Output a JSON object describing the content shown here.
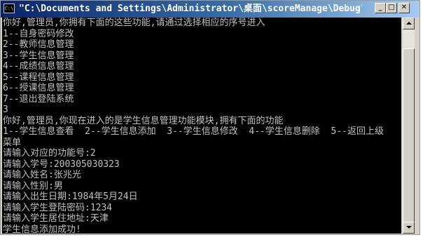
{
  "window": {
    "title": "\"C:\\Documents and Settings\\Administrator\\桌面\\scoreManage\\Debug\\score...",
    "icon_label": "C:\\",
    "icon": "console-app-icon"
  },
  "controls": {
    "minimize_symbol": "_",
    "maximize_symbol": "□",
    "close_symbol": "✕"
  },
  "console": {
    "lines": [
      "你好,管理员,你拥有下面的这些功能,请通过选择相应的序号进入",
      "1--自身密码修改",
      "2--教师信息管理",
      "3--学生信息管理",
      "4--成绩信息管理",
      "5--课程信息管理",
      "6--授课信息管理",
      "7--退出登陆系统",
      "3",
      "你好,管理员,你现在进入的是学生信息管理功能模块,拥有下面的功能",
      "1--学生信息查看  2--学生信息添加  3--学生信息修改  4--学生信息删除  5--返回上级",
      "菜单",
      "请输入对应的功能号:2",
      "请输入学号:200305030323",
      "请输入姓名:张兆光",
      "请输入性别:男",
      "请输入出生日期:1984年5月24日",
      "请输入学生登陆密码:1234",
      "请输入学生居住地址:天津",
      "学生信息添加成功!"
    ]
  }
}
